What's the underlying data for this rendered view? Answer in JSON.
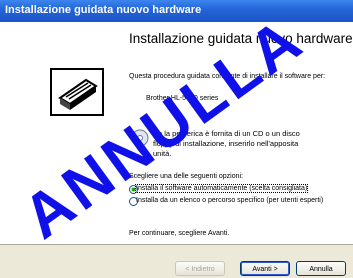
{
  "window": {
    "title": "Installazione guidata nuovo hardware"
  },
  "wizard": {
    "heading": "Installazione guidata nuovo hardware",
    "intro": "Questa procedura guidata consente di installare il software per:",
    "device": "Brother HL-5000 series",
    "cd_note_line1": "Se la periferica è fornita di un CD o un disco",
    "cd_note_line2": "floppy di installazione, inserirlo nell'apposita",
    "cd_note_line3": "unità.",
    "question": "Scegliere una delle seguenti opzioni:",
    "options": [
      {
        "label": "Installa il software automaticamente (scelta consigliata)",
        "selected": true
      },
      {
        "label": "Installa da un elenco o percorso specifico (per utenti esperti)",
        "selected": false
      }
    ],
    "continue_text": "Per continuare, scegliere Avanti."
  },
  "buttons": {
    "back": "< Indietro",
    "next": "Avanti >",
    "cancel": "Annulla"
  },
  "stamp": {
    "text": "ANNULLA",
    "color": "#1010e8"
  }
}
